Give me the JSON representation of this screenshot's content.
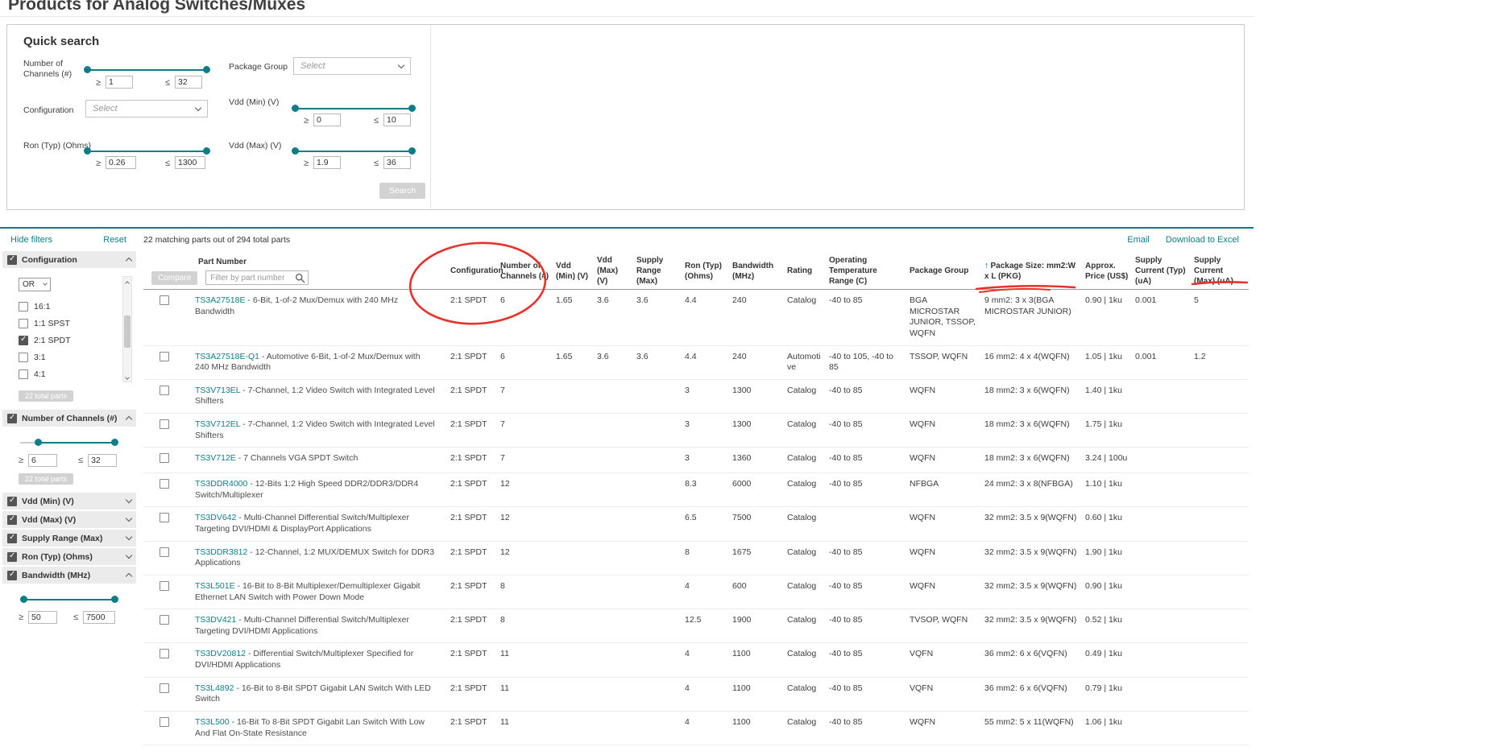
{
  "colors": {
    "accent": "#0e7d8a",
    "annotation": "#e8312a"
  },
  "symbols": {
    "ge": "≥",
    "le": "≤"
  },
  "page": {
    "title": "Products for Analog Switches/Muxes"
  },
  "quick_search": {
    "title": "Quick search",
    "search_button": "Search",
    "channels": {
      "label": "Number of Channels (#)",
      "min": "1",
      "max": "32"
    },
    "package_group": {
      "label": "Package Group",
      "value": "Select"
    },
    "configuration": {
      "label": "Configuration",
      "value": "Select"
    },
    "vdd_min": {
      "label": "Vdd (Min) (V)",
      "min": "0",
      "max": "10"
    },
    "ron": {
      "label": "Ron (Typ) (Ohms)",
      "min": "0.26",
      "max": "1300"
    },
    "vdd_max": {
      "label": "Vdd (Max) (V)",
      "min": "1.9",
      "max": "36"
    }
  },
  "sidebar": {
    "hide_filters": "Hide filters",
    "reset": "Reset",
    "configuration": {
      "label": "Configuration",
      "operator": "OR",
      "options": [
        {
          "label": "16:1",
          "checked": false
        },
        {
          "label": "1:1 SPST",
          "checked": false
        },
        {
          "label": "2:1 SPDT",
          "checked": true
        },
        {
          "label": "3:1",
          "checked": false
        },
        {
          "label": "4:1",
          "checked": false
        }
      ],
      "apply_button": "22 total parts"
    },
    "channels": {
      "label": "Number of Channels (#)",
      "min": "6",
      "max": "32",
      "apply_button": "22 total parts"
    },
    "collapsed_sections": [
      "Vdd (Min) (V)",
      "Vdd (Max) (V)",
      "Supply Range (Max)",
      "Ron (Typ) (Ohms)"
    ],
    "bandwidth": {
      "label": "Bandwidth (MHz)",
      "min": "50",
      "max": "7500"
    }
  },
  "results": {
    "summary": "22 matching parts out of 294 total parts",
    "email_link": "Email",
    "download_link": "Download to Excel",
    "compare_button": "Compare",
    "part_filter_placeholder": "Filter by part number",
    "part_separator": " - ",
    "columns": [
      "Part Number",
      "Configuration",
      "Number of Channels (#)",
      "Vdd (Min) (V)",
      "Vdd (Max) (V)",
      "Supply Range (Max)",
      "Ron (Typ) (Ohms)",
      "Bandwidth (MHz)",
      "Rating",
      "Operating Temperature Range (C)",
      "Package Group",
      "Package Size: mm2:W x L (PKG)",
      "Approx. Price (US$)",
      "Supply Current (Typ) (uA)",
      "Supply Current (Max) (uA)"
    ],
    "rows": [
      {
        "part": "TS3A27518E",
        "desc": "6-Bit, 1-of-2 Mux/Demux with 240 MHz Bandwidth",
        "config": "2:1 SPDT",
        "channels": "6",
        "vdd_min": "1.65",
        "vdd_max": "3.6",
        "supply_range": "3.6",
        "ron": "4.4",
        "bandwidth": "240",
        "rating": "Catalog",
        "temp": "-40 to 85",
        "pkg_group": "BGA MICROSTAR JUNIOR, TSSOP, WQFN",
        "pkg_size": "9 mm2: 3 x 3(BGA MICROSTAR JUNIOR)",
        "price": "0.90 | 1ku",
        "i_typ": "0.001",
        "i_max": "5"
      },
      {
        "part": "TS3A27518E-Q1",
        "desc": "Automotive 6-Bit, 1-of-2 Mux/Demux with 240 MHz Bandwidth",
        "config": "2:1 SPDT",
        "channels": "6",
        "vdd_min": "1.65",
        "vdd_max": "3.6",
        "supply_range": "3.6",
        "ron": "4.4",
        "bandwidth": "240",
        "rating": "Automotive",
        "temp": "-40 to 105, -40 to 85",
        "pkg_group": "TSSOP, WQFN",
        "pkg_size": "16 mm2: 4 x 4(WQFN)",
        "price": "1.05 | 1ku",
        "i_typ": "0.001",
        "i_max": "1.2"
      },
      {
        "part": "TS3V713EL",
        "desc": "7-Channel, 1:2 Video Switch with Integrated Level Shifters",
        "config": "2:1 SPDT",
        "channels": "7",
        "vdd_min": "",
        "vdd_max": "",
        "supply_range": "",
        "ron": "3",
        "bandwidth": "1300",
        "rating": "Catalog",
        "temp": "-40 to 85",
        "pkg_group": "WQFN",
        "pkg_size": "18 mm2: 3 x 6(WQFN)",
        "price": "1.40 | 1ku",
        "i_typ": "",
        "i_max": ""
      },
      {
        "part": "TS3V712EL",
        "desc": "7-Channel, 1:2 Video Switch with Integrated Level Shifters",
        "config": "2:1 SPDT",
        "channels": "7",
        "vdd_min": "",
        "vdd_max": "",
        "supply_range": "",
        "ron": "3",
        "bandwidth": "1300",
        "rating": "Catalog",
        "temp": "-40 to 85",
        "pkg_group": "WQFN",
        "pkg_size": "18 mm2: 3 x 6(WQFN)",
        "price": "1.75 | 1ku",
        "i_typ": "",
        "i_max": ""
      },
      {
        "part": "TS3V712E",
        "desc": "7 Channels VGA SPDT Switch",
        "config": "2:1 SPDT",
        "channels": "7",
        "vdd_min": "",
        "vdd_max": "",
        "supply_range": "",
        "ron": "3",
        "bandwidth": "1360",
        "rating": "Catalog",
        "temp": "-40 to 85",
        "pkg_group": "WQFN",
        "pkg_size": "18 mm2: 3 x 6(WQFN)",
        "price": "3.24 | 100u",
        "i_typ": "",
        "i_max": ""
      },
      {
        "part": "TS3DDR4000",
        "desc": "12-Bits 1:2 High Speed DDR2/DDR3/DDR4 Switch/Multiplexer",
        "config": "2:1 SPDT",
        "channels": "12",
        "vdd_min": "",
        "vdd_max": "",
        "supply_range": "",
        "ron": "8.3",
        "bandwidth": "6000",
        "rating": "Catalog",
        "temp": "-40 to 85",
        "pkg_group": "NFBGA",
        "pkg_size": "24 mm2: 3 x 8(NFBGA)",
        "price": "1.10 | 1ku",
        "i_typ": "",
        "i_max": ""
      },
      {
        "part": "TS3DV642",
        "desc": "Multi-Channel Differential Switch/Multiplexer Targeting DVI/HDMI & DisplayPort Applications",
        "config": "2:1 SPDT",
        "channels": "12",
        "vdd_min": "",
        "vdd_max": "",
        "supply_range": "",
        "ron": "6.5",
        "bandwidth": "7500",
        "rating": "Catalog",
        "temp": "",
        "pkg_group": "WQFN",
        "pkg_size": "32 mm2: 3.5 x 9(WQFN)",
        "price": "0.60 | 1ku",
        "i_typ": "",
        "i_max": ""
      },
      {
        "part": "TS3DDR3812",
        "desc": "12-Channel, 1:2 MUX/DEMUX Switch for DDR3 Applications",
        "config": "2:1 SPDT",
        "channels": "12",
        "vdd_min": "",
        "vdd_max": "",
        "supply_range": "",
        "ron": "8",
        "bandwidth": "1675",
        "rating": "Catalog",
        "temp": "-40 to 85",
        "pkg_group": "WQFN",
        "pkg_size": "32 mm2: 3.5 x 9(WQFN)",
        "price": "1.90 | 1ku",
        "i_typ": "",
        "i_max": ""
      },
      {
        "part": "TS3L501E",
        "desc": "16-Bit to 8-Bit Multiplexer/Demultiplexer Gigabit Ethernet LAN Switch with Power Down Mode",
        "config": "2:1 SPDT",
        "channels": "8",
        "vdd_min": "",
        "vdd_max": "",
        "supply_range": "",
        "ron": "4",
        "bandwidth": "600",
        "rating": "Catalog",
        "temp": "-40 to 85",
        "pkg_group": "WQFN",
        "pkg_size": "32 mm2: 3.5 x 9(WQFN)",
        "price": "0.90 | 1ku",
        "i_typ": "",
        "i_max": ""
      },
      {
        "part": "TS3DV421",
        "desc": "Multi-Channel Differential Switch/Multiplexer Targeting DVI/HDMI Applications",
        "config": "2:1 SPDT",
        "channels": "8",
        "vdd_min": "",
        "vdd_max": "",
        "supply_range": "",
        "ron": "12.5",
        "bandwidth": "1900",
        "rating": "Catalog",
        "temp": "-40 to 85",
        "pkg_group": "TVSOP, WQFN",
        "pkg_size": "32 mm2: 3.5 x 9(WQFN)",
        "price": "0.52 | 1ku",
        "i_typ": "",
        "i_max": ""
      },
      {
        "part": "TS3DV20812",
        "desc": "Differential Switch/Multiplexer Specified for DVI/HDMI Applications",
        "config": "2:1 SPDT",
        "channels": "11",
        "vdd_min": "",
        "vdd_max": "",
        "supply_range": "",
        "ron": "4",
        "bandwidth": "1100",
        "rating": "Catalog",
        "temp": "-40 to 85",
        "pkg_group": "VQFN",
        "pkg_size": "36 mm2: 6 x 6(VQFN)",
        "price": "0.49 | 1ku",
        "i_typ": "",
        "i_max": ""
      },
      {
        "part": "TS3L4892",
        "desc": "16-Bit to 8-Bit SPDT Gigabit LAN Switch With LED Switch",
        "config": "2:1 SPDT",
        "channels": "11",
        "vdd_min": "",
        "vdd_max": "",
        "supply_range": "",
        "ron": "4",
        "bandwidth": "1100",
        "rating": "Catalog",
        "temp": "-40 to 85",
        "pkg_group": "VQFN",
        "pkg_size": "36 mm2: 6 x 6(VQFN)",
        "price": "0.79 | 1ku",
        "i_typ": "",
        "i_max": ""
      },
      {
        "part": "TS3L500",
        "desc": "16-Bit To 8-Bit SPDT Gigabit Lan Switch With Low And Flat On-State Resistance",
        "config": "2:1 SPDT",
        "channels": "11",
        "vdd_min": "",
        "vdd_max": "",
        "supply_range": "",
        "ron": "4",
        "bandwidth": "1100",
        "rating": "Catalog",
        "temp": "-40 to 85",
        "pkg_group": "WQFN",
        "pkg_size": "55 mm2: 5 x 11(WQFN)",
        "price": "1.06 | 1ku",
        "i_typ": "",
        "i_max": ""
      }
    ]
  }
}
